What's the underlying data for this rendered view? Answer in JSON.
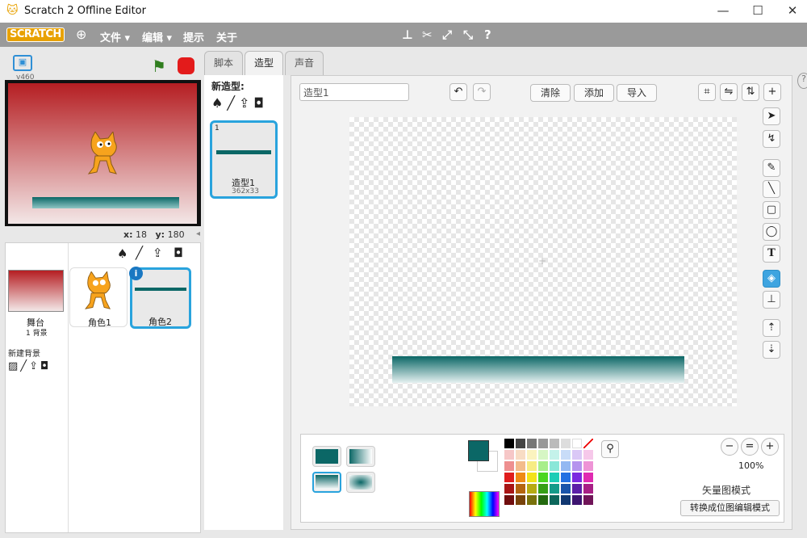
{
  "window": {
    "title": "Scratch 2 Offline Editor",
    "minimize": "—",
    "maximize": "☐",
    "close": "✕"
  },
  "menubar": {
    "logo": "SCRATCH",
    "file": "文件 ▾",
    "edit": "编辑 ▾",
    "tips": "提示",
    "about": "关于"
  },
  "stage": {
    "version": "v460",
    "x_label": "x:",
    "x_value": "18",
    "y_label": "y:",
    "y_value": "180"
  },
  "sprite_panel": {
    "stage_label": "舞台",
    "stage_backdrops": "1 背景",
    "new_backdrop": "新建背景",
    "sprites": [
      {
        "name": "角色1"
      },
      {
        "name": "角色2"
      }
    ]
  },
  "tabs": {
    "scripts": "脚本",
    "costumes": "造型",
    "sounds": "声音"
  },
  "costume_list": {
    "header": "新造型:",
    "items": [
      {
        "index": "1",
        "name": "造型1",
        "size": "362x33"
      }
    ]
  },
  "editor": {
    "name_value": "造型1",
    "clear": "清除",
    "add": "添加",
    "import": "导入",
    "zoom": "100%",
    "vector_mode": "矢量图模式",
    "convert_button": "转换成位图编辑模式"
  },
  "colors": {
    "accent": "#0b6766",
    "stage_top": "#b51e22",
    "stage_bottom": "#f3e7e7",
    "menubar": "#9a9a9a",
    "selection": "#29a3dd",
    "green_flag": "#2f7d1e",
    "stop": "#e31b1b"
  }
}
